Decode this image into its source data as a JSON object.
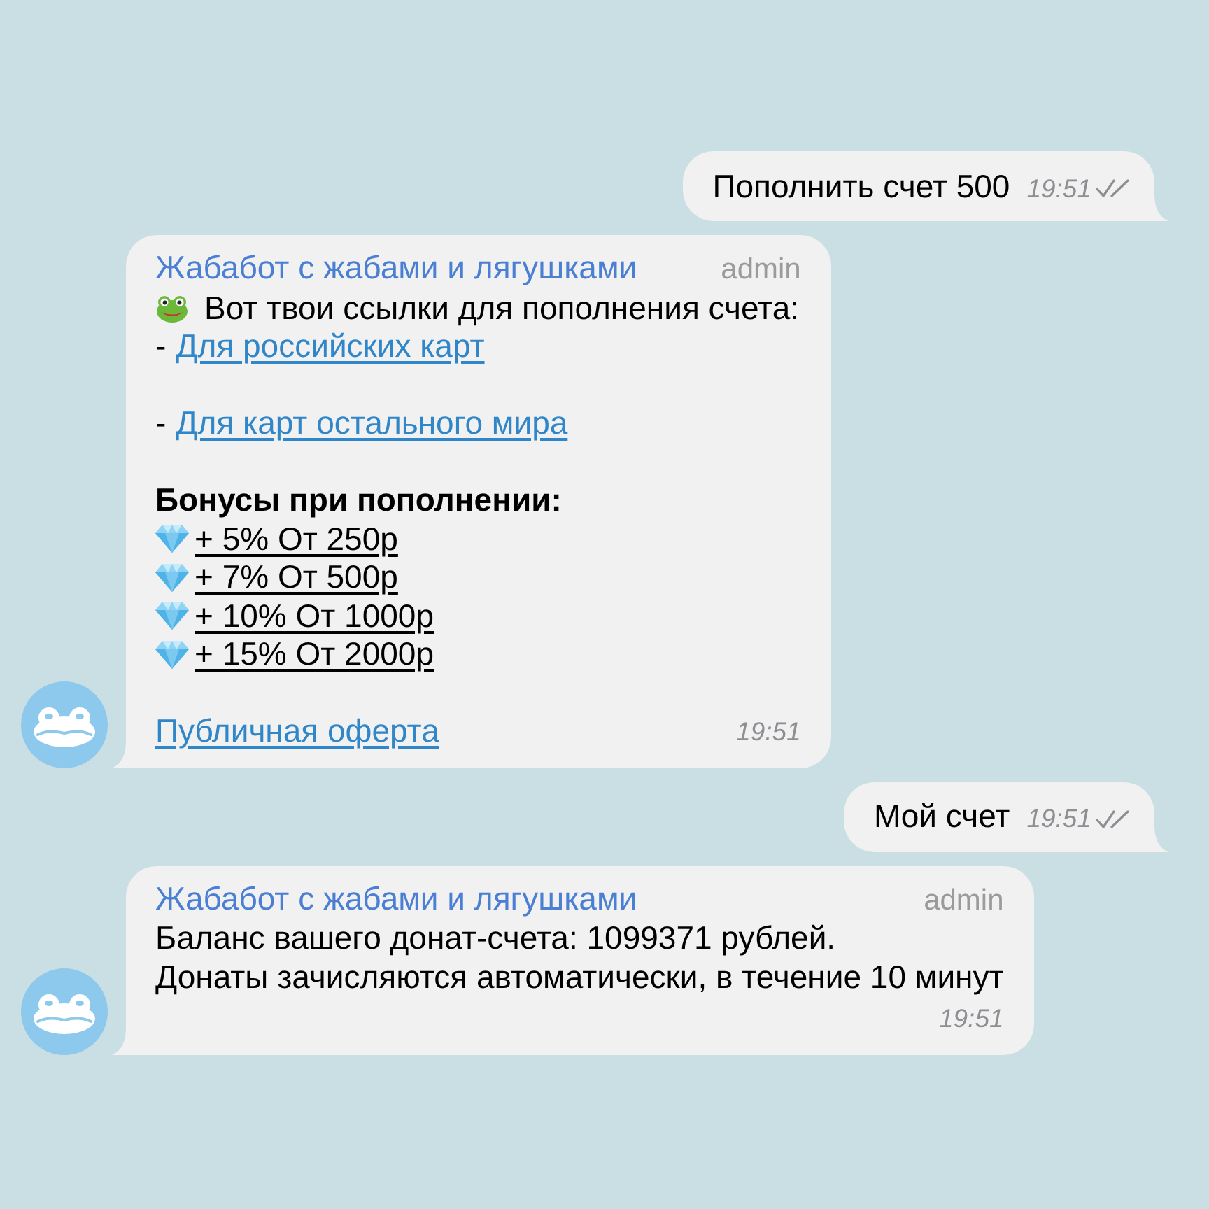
{
  "messages": [
    {
      "kind": "outgoing",
      "text": "Пополнить счет 500",
      "time": "19:51",
      "read": true
    },
    {
      "kind": "incoming",
      "sender": "Жабабот с жабами и лягушками",
      "role": "admin",
      "lines": [
        {
          "kind": "frog",
          "text": "Вот твои ссылки для пополнения счета:"
        },
        {
          "kind": "link",
          "prefix": "-",
          "text": "Для российских карт"
        },
        {
          "kind": "blank"
        },
        {
          "kind": "link",
          "prefix": "-",
          "text": "Для карт остального мира"
        },
        {
          "kind": "blank"
        },
        {
          "kind": "heading",
          "text": "Бонусы при пополнении:"
        },
        {
          "kind": "bonus",
          "text": "+ 5% От 250р"
        },
        {
          "kind": "bonus",
          "text": "+ 7% От 500р"
        },
        {
          "kind": "bonus",
          "text": "+ 10% От 1000р"
        },
        {
          "kind": "bonus",
          "text": "+ 15% От 2000р"
        },
        {
          "kind": "blank"
        }
      ],
      "footer_link": "Публичная оферта",
      "time": "19:51"
    },
    {
      "kind": "outgoing",
      "text": "Мой счет",
      "time": "19:51",
      "read": true
    },
    {
      "kind": "incoming",
      "sender": "Жабабот с жабами и лягушками",
      "role": "admin",
      "lines": [
        {
          "kind": "text",
          "text": "Баланс вашего донат-счета: 1099371 рублей."
        },
        {
          "kind": "text",
          "text": "Донаты зачисляются автоматически, в течение 10 минут"
        }
      ],
      "time": "19:51"
    }
  ]
}
